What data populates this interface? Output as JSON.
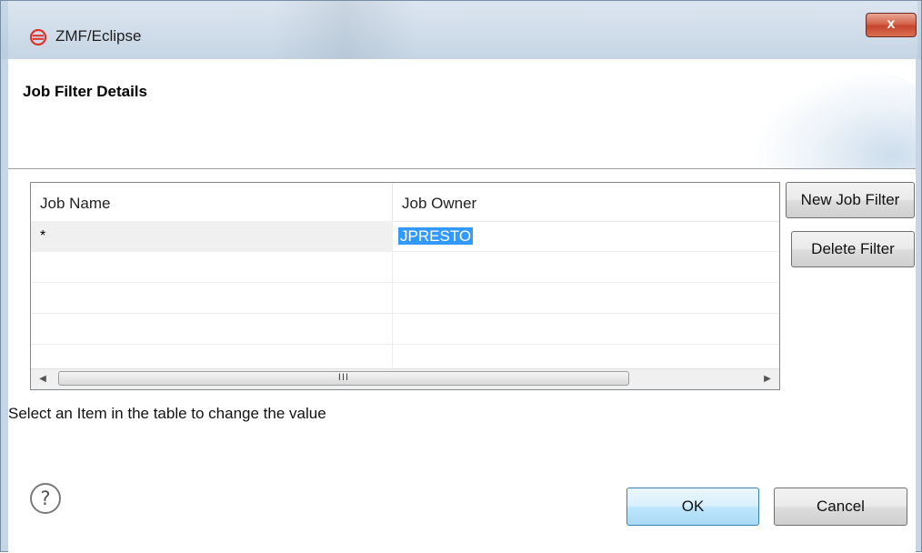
{
  "window": {
    "title": "ZMF/Eclipse",
    "close_label": "x"
  },
  "banner": {
    "title": "Job Filter Details"
  },
  "table": {
    "columns": [
      "Job Name",
      "Job Owner"
    ],
    "rows": [
      {
        "job_name": "*",
        "job_owner": "JPRESTO"
      }
    ],
    "scrollbar_grip": "III"
  },
  "buttons": {
    "new_job_filter": "New Job Filter",
    "delete_filter": "Delete Filter",
    "ok": "OK",
    "cancel": "Cancel"
  },
  "hint": "Select an Item in the table to change the value",
  "help": "?",
  "colors": {
    "selection": "#3399ff",
    "app_icon": "#e0312a",
    "close_button": "#c7452c"
  }
}
